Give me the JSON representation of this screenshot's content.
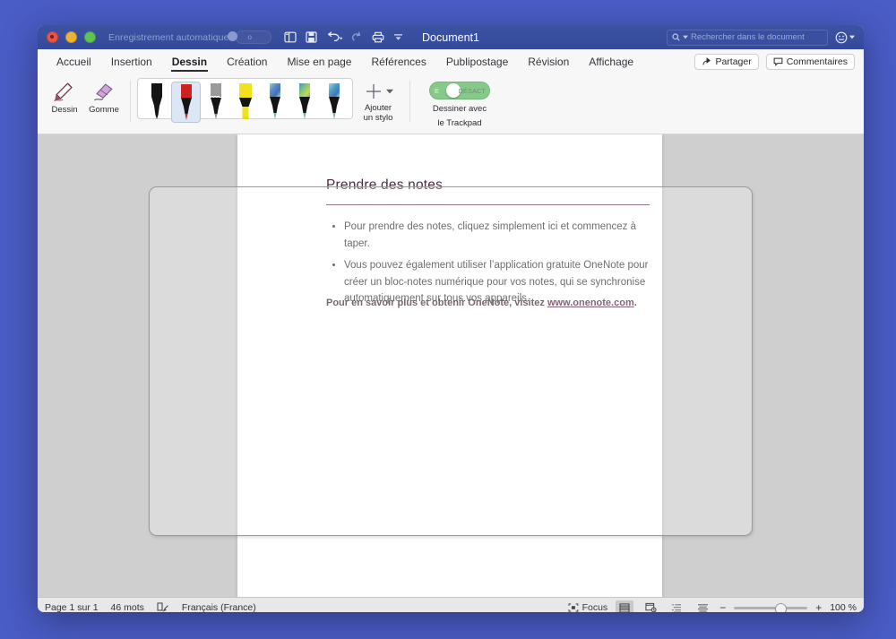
{
  "titlebar": {
    "autosave_label": "Enregistrement automatique",
    "autosave_state": "o",
    "document_title": "Document1",
    "search_placeholder": "Rechercher dans le document",
    "icons": [
      "sidebar-icon",
      "save-icon",
      "undo-icon",
      "redo-icon",
      "print-icon",
      "customize-toolbar-icon"
    ]
  },
  "ribbon": {
    "tabs": [
      {
        "label": "Accueil",
        "active": false
      },
      {
        "label": "Insertion",
        "active": false
      },
      {
        "label": "Dessin",
        "active": true
      },
      {
        "label": "Création",
        "active": false
      },
      {
        "label": "Mise en page",
        "active": false
      },
      {
        "label": "Références",
        "active": false
      },
      {
        "label": "Publipostage",
        "active": false
      },
      {
        "label": "Révision",
        "active": false
      },
      {
        "label": "Affichage",
        "active": false
      }
    ],
    "share_label": "Partager",
    "comments_label": "Commentaires",
    "tools": [
      {
        "label": "Dessin",
        "icon": "pen-draw-icon"
      },
      {
        "label": "Gomme",
        "icon": "eraser-icon"
      }
    ],
    "pens": [
      {
        "name": "pen-black",
        "color": "#111111",
        "tip": "#111111",
        "type": "pen",
        "selected": false
      },
      {
        "name": "pen-red",
        "color": "#cc2222",
        "tip": "#b0343c",
        "type": "pen",
        "selected": true
      },
      {
        "name": "pencil-gray",
        "color": "#9a9a9a",
        "tip": "#8f8f8f",
        "type": "pencil",
        "selected": false
      },
      {
        "name": "highlighter-yellow",
        "color": "#f2e21e",
        "tip": "#f2e21e",
        "type": "highlighter",
        "selected": false
      },
      {
        "name": "pen-rainbow-blue",
        "color": "#5a8fc6",
        "tip": "#7fb3b8",
        "type": "pen-effect",
        "selected": false
      },
      {
        "name": "pen-rainbow-green",
        "color": "#6bbf6a",
        "tip": "#79b58e",
        "type": "pen-effect",
        "selected": false
      },
      {
        "name": "pen-rainbow-teal",
        "color": "#58b4c8",
        "tip": "#7fb3b8",
        "type": "pen-effect",
        "selected": false
      }
    ],
    "add_pen_label_line1": "Ajouter",
    "add_pen_label_line2": "un stylo",
    "trackpad": {
      "label_line1": "Dessiner avec",
      "label_line2": "le Trackpad",
      "on_text": "E",
      "off_text": "DÉSACT",
      "state": "on",
      "accent": "#86c98a"
    }
  },
  "document": {
    "heading": "Prendre des notes",
    "bullets": [
      "Pour prendre des notes, cliquez simplement ici et commencez à taper.",
      "Vous pouvez également utiliser l’application gratuite OneNote pour créer un bloc-notes numérique pour vos notes, qui se synchronise automatiquement sur tous vos appareils."
    ],
    "footnote_prefix": "Pour en savoir plus et obtenir OneNote, visitez ",
    "footnote_link": "www.onenote.com",
    "footnote_suffix": "."
  },
  "statusbar": {
    "page_label": "Page 1 sur 1",
    "words_label": "46 mots",
    "proofing_icon": "proofing-icon",
    "language_label": "Français (France)",
    "focus_label": "Focus",
    "view_modes": [
      "print-layout-icon",
      "web-layout-icon",
      "outline-icon",
      "draft-icon"
    ],
    "zoom_out": "−",
    "zoom_in": "+",
    "zoom_level": "100 %"
  }
}
